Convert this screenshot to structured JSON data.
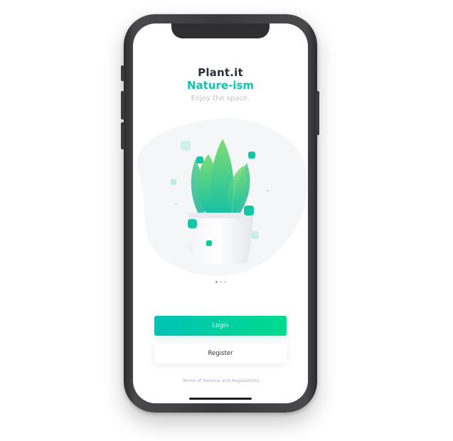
{
  "app": {
    "title": "Plant.it",
    "subtitle": "Nature-ism",
    "tagline": "Enjoy the space."
  },
  "pagination": {
    "total": 3,
    "active": 1
  },
  "actions": {
    "login_label": "Login",
    "register_label": "Register"
  },
  "footer": {
    "terms_label": "Terms of Service and Regulations"
  },
  "colors": {
    "accent": "#12c2b0",
    "gradient_start": "#00c2b6",
    "gradient_end": "#00db8c",
    "title": "#2b2e3a",
    "device": "#3a3a3c"
  }
}
